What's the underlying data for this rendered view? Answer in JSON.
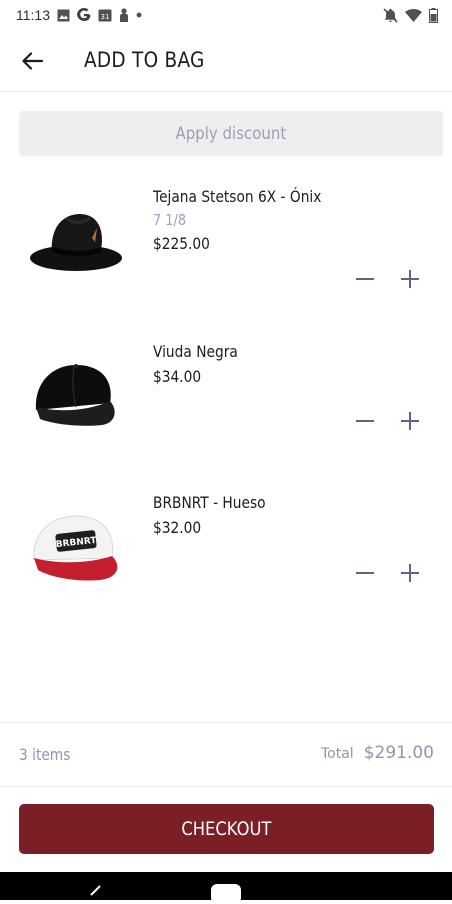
{
  "status_bar": {
    "time": "11:13",
    "left_icons": [
      "image-icon",
      "google-icon",
      "calendar-icon",
      "person-alert-icon",
      "dot-icon"
    ],
    "right_icons": [
      "notifications-off-icon",
      "wifi-icon",
      "battery-icon"
    ]
  },
  "header": {
    "back_icon": "arrow-left-icon",
    "title": "ADD TO BAG"
  },
  "discount": {
    "label": "Apply discount"
  },
  "items": [
    {
      "name": "Tejana Stetson 6X - Ónix",
      "variant": "7 1/8",
      "price": "$225.00",
      "image": "black-cowboy-hat"
    },
    {
      "name": "Viuda Negra",
      "variant": "",
      "price": "$34.00",
      "image": "black-snapback-cap"
    },
    {
      "name": "BRBNRT - Hueso",
      "variant": "",
      "price": "$32.00",
      "image": "white-red-trucker-cap"
    }
  ],
  "summary": {
    "items_count": "3 items",
    "total_label": "Total",
    "total_value": "$291.00"
  },
  "checkout": {
    "label": "CHECKOUT"
  },
  "colors": {
    "accent": "#7b1f27",
    "muted_text": "#8f96ad",
    "variant_text": "#9aa0c0",
    "discount_bg": "#eeeeee"
  }
}
